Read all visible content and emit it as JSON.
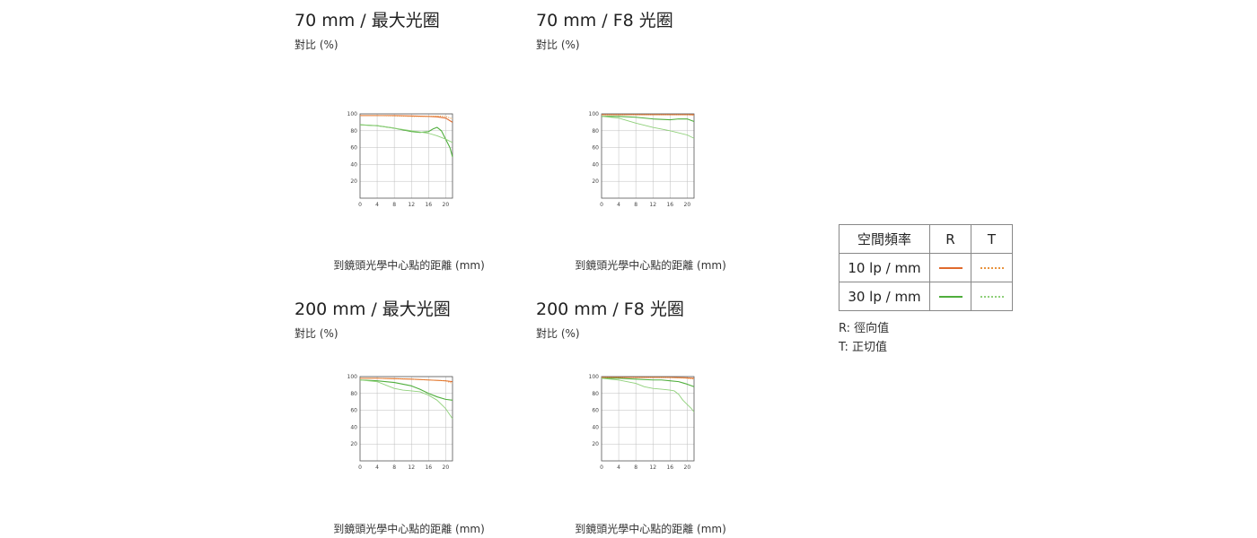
{
  "colors": {
    "r10": "#e06a2c",
    "t10": "#e8933f",
    "r30": "#4fae3c",
    "t30": "#8fd07a"
  },
  "chart_data": [
    {
      "type": "line",
      "title": "70 mm / 最大光圈",
      "ylabel": "對比 (%)",
      "xlabel": "到鏡頭光學中心點的距離 (mm)",
      "xlim": [
        0,
        21.6
      ],
      "ylim": [
        0,
        100
      ],
      "xticks": [
        0,
        4,
        8,
        12,
        16,
        20
      ],
      "yticks": [
        20,
        40,
        60,
        80,
        100
      ],
      "grid": true,
      "series": [
        {
          "key": "r10",
          "style": "solid",
          "x": [
            0,
            4,
            8,
            12,
            16,
            18,
            20,
            21.6
          ],
          "y": [
            98,
            98,
            98,
            97.5,
            97,
            96.5,
            95,
            90
          ]
        },
        {
          "key": "t10",
          "style": "dot",
          "x": [
            0,
            4,
            8,
            12,
            16,
            18,
            20,
            21.6
          ],
          "y": [
            98,
            98,
            97.5,
            97,
            97,
            97.5,
            97,
            94
          ]
        },
        {
          "key": "r30",
          "style": "solid",
          "x": [
            0,
            4,
            8,
            12,
            14,
            16,
            17,
            18,
            19,
            20,
            21,
            21.6
          ],
          "y": [
            87,
            86,
            83,
            79,
            78,
            79,
            82,
            84,
            80,
            70,
            60,
            49
          ]
        },
        {
          "key": "t30",
          "style": "thin",
          "x": [
            0,
            4,
            8,
            12,
            16,
            18,
            20,
            21.6
          ],
          "y": [
            87,
            86,
            83,
            80,
            77,
            74,
            70,
            66
          ]
        }
      ]
    },
    {
      "type": "line",
      "title": "70 mm / F8 光圈",
      "ylabel": "對比 (%)",
      "xlabel": "到鏡頭光學中心點的距離 (mm)",
      "xlim": [
        0,
        21.6
      ],
      "ylim": [
        0,
        100
      ],
      "xticks": [
        0,
        4,
        8,
        12,
        16,
        20
      ],
      "yticks": [
        20,
        40,
        60,
        80,
        100
      ],
      "grid": true,
      "series": [
        {
          "key": "r10",
          "style": "solid",
          "x": [
            0,
            4,
            8,
            12,
            16,
            20,
            21.6
          ],
          "y": [
            99,
            99,
            99,
            99,
            99,
            99,
            99
          ]
        },
        {
          "key": "t10",
          "style": "dot",
          "x": [
            0,
            4,
            8,
            12,
            16,
            20,
            21.6
          ],
          "y": [
            99,
            99,
            99,
            99,
            99,
            99,
            98.5
          ]
        },
        {
          "key": "r30",
          "style": "solid",
          "x": [
            0,
            4,
            8,
            12,
            16,
            18,
            20,
            21.6
          ],
          "y": [
            97,
            97,
            96,
            94,
            93,
            94,
            94,
            91
          ]
        },
        {
          "key": "t30",
          "style": "thin",
          "x": [
            0,
            4,
            8,
            12,
            16,
            20,
            21.6
          ],
          "y": [
            97,
            95,
            89,
            84,
            80,
            75,
            71
          ]
        }
      ]
    },
    {
      "type": "line",
      "title": "200 mm / 最大光圈",
      "ylabel": "對比 (%)",
      "xlabel": "到鏡頭光學中心點的距離 (mm)",
      "xlim": [
        0,
        21.6
      ],
      "ylim": [
        0,
        100
      ],
      "xticks": [
        0,
        4,
        8,
        12,
        16,
        20
      ],
      "yticks": [
        20,
        40,
        60,
        80,
        100
      ],
      "grid": true,
      "series": [
        {
          "key": "r10",
          "style": "solid",
          "x": [
            0,
            4,
            8,
            12,
            16,
            20,
            21.6
          ],
          "y": [
            98,
            98,
            97.5,
            97,
            96,
            95,
            94
          ]
        },
        {
          "key": "t10",
          "style": "dot",
          "x": [
            0,
            4,
            8,
            12,
            16,
            20,
            21.6
          ],
          "y": [
            98,
            98,
            97.5,
            97,
            96,
            95,
            92
          ]
        },
        {
          "key": "r30",
          "style": "solid",
          "x": [
            0,
            4,
            8,
            10,
            12,
            14,
            16,
            18,
            20,
            21.6
          ],
          "y": [
            96,
            95,
            93,
            91,
            89,
            85,
            80,
            76,
            73,
            72
          ]
        },
        {
          "key": "t30",
          "style": "thin",
          "x": [
            0,
            4,
            6,
            8,
            10,
            12,
            14,
            16,
            18,
            20,
            21.6
          ],
          "y": [
            96,
            94,
            90,
            86,
            84,
            83,
            82,
            78,
            72,
            62,
            50
          ]
        }
      ]
    },
    {
      "type": "line",
      "title": "200 mm / F8 光圈",
      "ylabel": "對比 (%)",
      "xlabel": "到鏡頭光學中心點的距離 (mm)",
      "xlim": [
        0,
        21.6
      ],
      "ylim": [
        0,
        100
      ],
      "xticks": [
        0,
        4,
        8,
        12,
        16,
        20
      ],
      "yticks": [
        20,
        40,
        60,
        80,
        100
      ],
      "grid": true,
      "series": [
        {
          "key": "r10",
          "style": "solid",
          "x": [
            0,
            4,
            8,
            12,
            16,
            20,
            21.6
          ],
          "y": [
            99,
            99,
            99,
            99,
            99,
            98.5,
            98
          ]
        },
        {
          "key": "t10",
          "style": "dot",
          "x": [
            0,
            4,
            8,
            12,
            16,
            20,
            21.6
          ],
          "y": [
            99,
            99,
            99,
            99,
            99,
            98,
            97
          ]
        },
        {
          "key": "r30",
          "style": "solid",
          "x": [
            0,
            4,
            8,
            12,
            14,
            16,
            18,
            20,
            21.6
          ],
          "y": [
            98,
            98,
            97,
            96,
            96,
            95,
            94,
            91,
            88
          ]
        },
        {
          "key": "t30",
          "style": "thin",
          "x": [
            0,
            4,
            8,
            10,
            12,
            14,
            16,
            17,
            18,
            19,
            20,
            21,
            21.6
          ],
          "y": [
            98,
            96,
            92,
            88,
            86,
            85,
            84,
            83,
            79,
            72,
            67,
            62,
            58
          ]
        }
      ]
    }
  ],
  "legend": {
    "header": [
      "空間頻率",
      "R",
      "T"
    ],
    "rows": [
      {
        "label": "10 lp / mm",
        "r_key": "r10",
        "t_key": "t10"
      },
      {
        "label": "30 lp / mm",
        "r_key": "r30",
        "t_key": "t30"
      }
    ],
    "notes": [
      "R: 徑向值",
      "T: 正切值"
    ]
  }
}
